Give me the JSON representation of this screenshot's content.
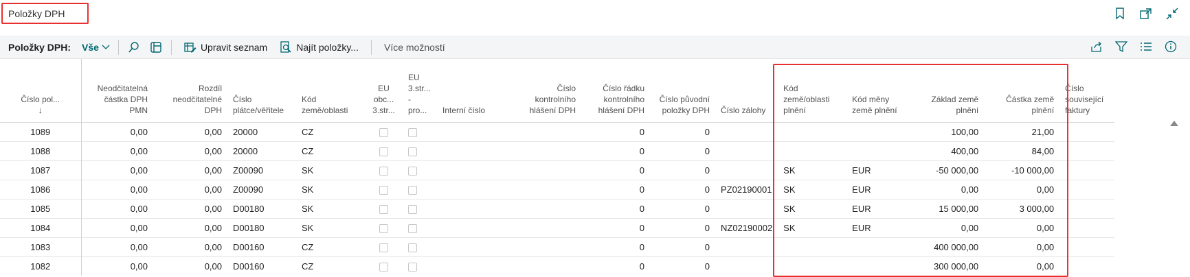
{
  "page": {
    "title": "Položky DPH"
  },
  "toolbar": {
    "label": "Položky DPH:",
    "view": "Vše",
    "edit_list": "Upravit seznam",
    "find_entries": "Najít položky...",
    "more_options": "Více možností"
  },
  "columns": [
    "Číslo pol...",
    "Neodčitatelná částka DPH PMN",
    "Rozdíl neodčitatelné DPH",
    "Číslo plátce/věřitele",
    "Kód země/oblasti",
    "EU obc... 3.str...",
    "EU 3.str... - pro...",
    "Interní číslo",
    "Číslo kontrolního hlášení DPH",
    "Číslo řádku kontrolního hlášení DPH",
    "Číslo původní položky DPH",
    "Číslo zálohy",
    "Kód země/oblasti plnění",
    "Kód měny země plnění",
    "Základ země plnění",
    "Částka země plnění",
    "Číslo související faktury"
  ],
  "rows": [
    {
      "no": "1089",
      "nondeduct_amt": "0,00",
      "nondeduct_diff": "0,00",
      "payer": "20000",
      "country": "CZ",
      "report_line": "0",
      "orig_entry": "0",
      "advance": "",
      "perf_country": "",
      "perf_currency": "",
      "perf_base": "100,00",
      "perf_amount": "21,00"
    },
    {
      "no": "1088",
      "nondeduct_amt": "0,00",
      "nondeduct_diff": "0,00",
      "payer": "20000",
      "country": "CZ",
      "report_line": "0",
      "orig_entry": "0",
      "advance": "",
      "perf_country": "",
      "perf_currency": "",
      "perf_base": "400,00",
      "perf_amount": "84,00"
    },
    {
      "no": "1087",
      "nondeduct_amt": "0,00",
      "nondeduct_diff": "0,00",
      "payer": "Z00090",
      "country": "SK",
      "report_line": "0",
      "orig_entry": "0",
      "advance": "",
      "perf_country": "SK",
      "perf_currency": "EUR",
      "perf_base": "-50 000,00",
      "perf_amount": "-10 000,00"
    },
    {
      "no": "1086",
      "nondeduct_amt": "0,00",
      "nondeduct_diff": "0,00",
      "payer": "Z00090",
      "country": "SK",
      "report_line": "0",
      "orig_entry": "0",
      "advance": "PZ02190001",
      "perf_country": "SK",
      "perf_currency": "EUR",
      "perf_base": "0,00",
      "perf_amount": "0,00"
    },
    {
      "no": "1085",
      "nondeduct_amt": "0,00",
      "nondeduct_diff": "0,00",
      "payer": "D00180",
      "country": "SK",
      "report_line": "0",
      "orig_entry": "0",
      "advance": "",
      "perf_country": "SK",
      "perf_currency": "EUR",
      "perf_base": "15 000,00",
      "perf_amount": "3 000,00"
    },
    {
      "no": "1084",
      "nondeduct_amt": "0,00",
      "nondeduct_diff": "0,00",
      "payer": "D00180",
      "country": "SK",
      "report_line": "0",
      "orig_entry": "0",
      "advance": "NZ02190002",
      "perf_country": "SK",
      "perf_currency": "EUR",
      "perf_base": "0,00",
      "perf_amount": "0,00"
    },
    {
      "no": "1083",
      "nondeduct_amt": "0,00",
      "nondeduct_diff": "0,00",
      "payer": "D00160",
      "country": "CZ",
      "report_line": "0",
      "orig_entry": "0",
      "advance": "",
      "perf_country": "",
      "perf_currency": "",
      "perf_base": "400 000,00",
      "perf_amount": "0,00"
    },
    {
      "no": "1082",
      "nondeduct_amt": "0,00",
      "nondeduct_diff": "0,00",
      "payer": "D00160",
      "country": "CZ",
      "report_line": "0",
      "orig_entry": "0",
      "advance": "",
      "perf_country": "",
      "perf_currency": "",
      "perf_base": "300 000,00",
      "perf_amount": "0,00"
    }
  ],
  "colors": {
    "accent": "#00676f",
    "highlight": "#e8312f"
  }
}
